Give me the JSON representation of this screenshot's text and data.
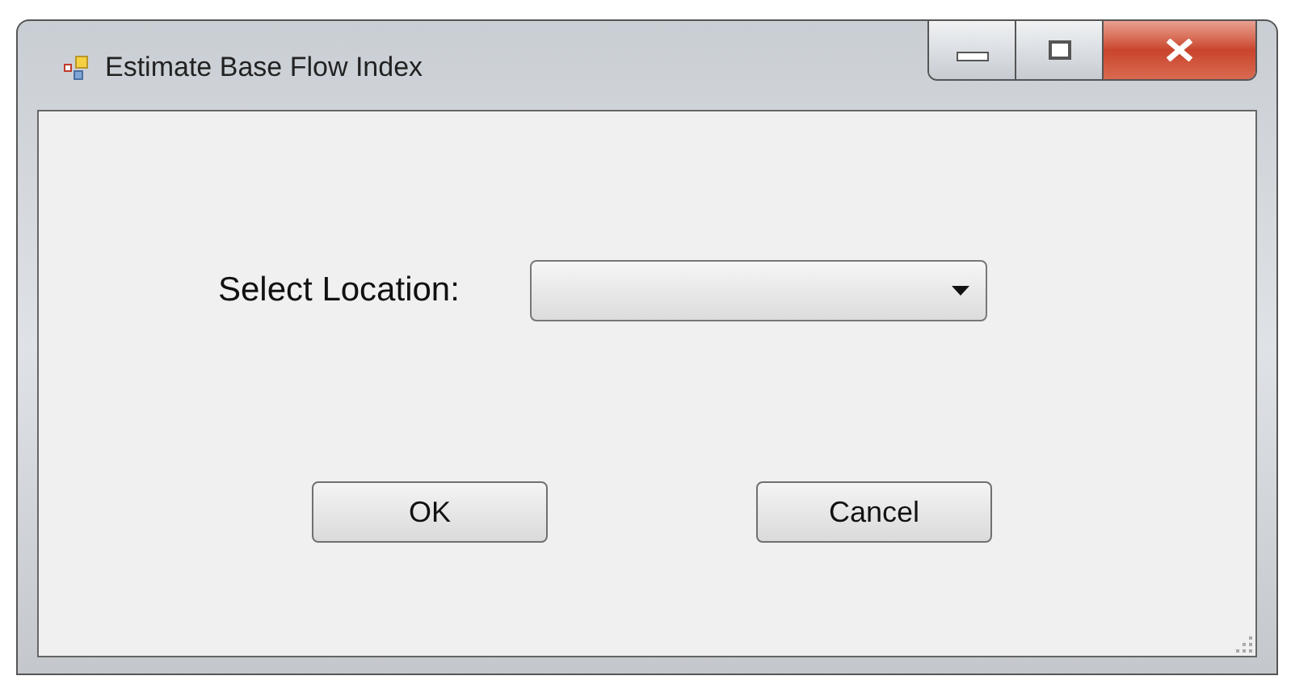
{
  "window": {
    "title": "Estimate Base Flow Index"
  },
  "location": {
    "label": "Select Location:"
  },
  "buttons": [
    {
      "label": "OK"
    },
    {
      "label": "Cancel"
    }
  ]
}
